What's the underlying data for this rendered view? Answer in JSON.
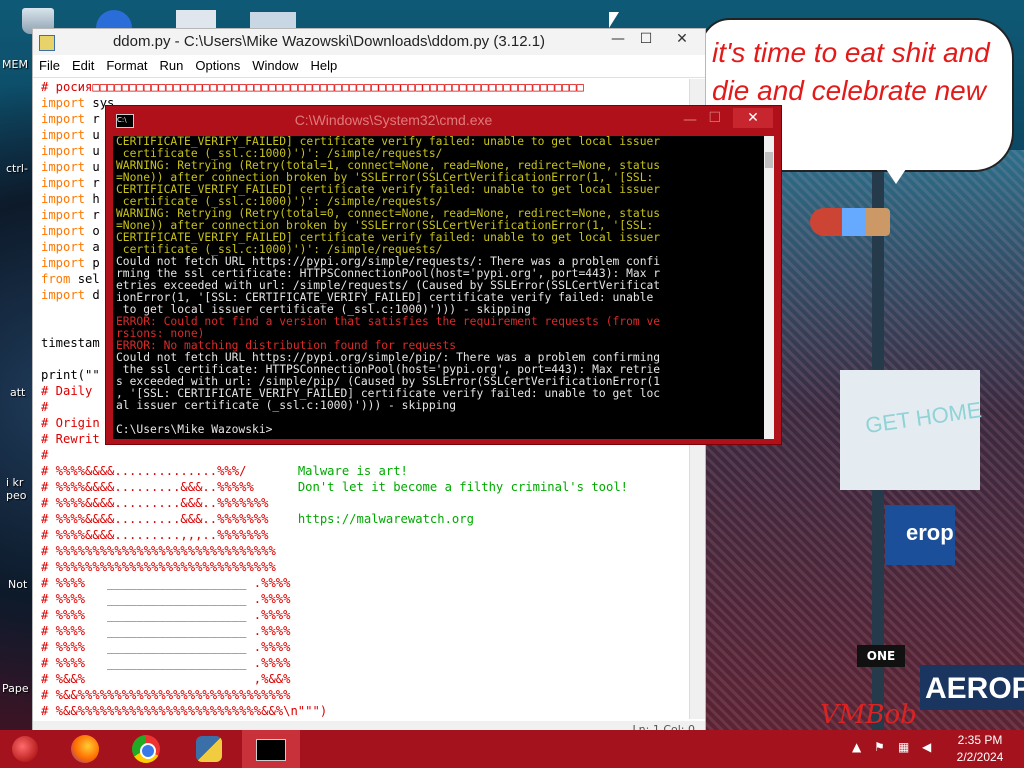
{
  "wallpaper": {
    "speech_bubble": "it's time to eat shit and die and celebrate new year",
    "sign_one": "ONE",
    "bldg1_text": "GET HOME",
    "bldg2_text": "erop",
    "bldg3_text": "AEROPOS",
    "signature": "VMBob"
  },
  "desktop_icons": [
    {
      "label": "MEM"
    },
    {
      "label": "ctrl-"
    },
    {
      "label": "att"
    },
    {
      "label": "i kr peo"
    },
    {
      "label": "Not"
    },
    {
      "label": "Pape"
    }
  ],
  "idle": {
    "title": "ddom.py - C:\\Users\\Mike Wazowski\\Downloads\\ddom.py (3.12.1)",
    "menu": [
      "File",
      "Edit",
      "Format",
      "Run",
      "Options",
      "Window",
      "Help"
    ],
    "status": "Ln: 1   Col: 0",
    "code_header": "# росия",
    "code_header_boxes": "□□□□□□□□□□□□□□□□□□□□□□□□□□□□□□□□□□□□□□□□□□□□□□□□□□□□□□□□□□□□□□□□□□□",
    "imports": [
      {
        "kw": "import",
        "rest": " sys"
      },
      {
        "kw": "import",
        "rest": " r"
      },
      {
        "kw": "import",
        "rest": " u"
      },
      {
        "kw": "import",
        "rest": " u"
      },
      {
        "kw": "import",
        "rest": " u"
      },
      {
        "kw": "import",
        "rest": " r"
      },
      {
        "kw": "import",
        "rest": " h"
      },
      {
        "kw": "import",
        "rest": " r"
      },
      {
        "kw": "import",
        "rest": " o"
      },
      {
        "kw": "import",
        "rest": " a"
      },
      {
        "kw": "import",
        "rest": " p"
      },
      {
        "kw": "from",
        "rest": " sel"
      },
      {
        "kw": "import",
        "rest": " d"
      }
    ],
    "timestamp_line": "timestam",
    "print_line": "print(\"\"",
    "comments": [
      "# Daily",
      "#",
      "# Origin",
      "# Rewrit",
      "#"
    ],
    "art_lines": [
      {
        "art": "# %%%%&&&&..............%%%/",
        "msg": "       Malware is art!"
      },
      {
        "art": "# %%%%&&&&.........&&&..%%%%%",
        "msg": "      Don't let it become a filthy criminal's tool!"
      },
      {
        "art": "# %%%%&&&&.........&&&..%%%%%%%",
        "msg": ""
      },
      {
        "art": "# %%%%&&&&.........&&&..%%%%%%%",
        "msg": "    https://malwarewatch.org"
      },
      {
        "art": "# %%%%&&&&.........,,,..%%%%%%%",
        "msg": ""
      },
      {
        "art": "# %%%%%%%%%%%%%%%%%%%%%%%%%%%%%%",
        "msg": ""
      },
      {
        "art": "# %%%%%%%%%%%%%%%%%%%%%%%%%%%%%%",
        "msg": ""
      },
      {
        "art": "# %%%%   ___________________ .%%%%",
        "msg": ""
      },
      {
        "art": "# %%%%   ___________________ .%%%%",
        "msg": ""
      },
      {
        "art": "# %%%%   ___________________ .%%%%",
        "msg": ""
      },
      {
        "art": "# %%%%   ___________________ .%%%%",
        "msg": ""
      },
      {
        "art": "# %%%%   ___________________ .%%%%",
        "msg": ""
      },
      {
        "art": "# %%%%   ___________________ .%%%%",
        "msg": ""
      },
      {
        "art": "# %&&%                       ,%&&%",
        "msg": ""
      },
      {
        "art": "# %&&%%%%%%%%%%%%%%%%%%%%%%%%%%%%%",
        "msg": ""
      },
      {
        "art": "# %&&%%%%%%%%%%%%%%%%%%%%%%%%%&&%\\n\"\"\")",
        "msg": ""
      }
    ]
  },
  "cmd": {
    "title": "C:\\Windows\\System32\\cmd.exe",
    "close_label": "✕",
    "lines": [
      {
        "c": "y",
        "t": "CERTIFICATE_VERIFY_FAILED] certificate verify failed: unable to get local issuer"
      },
      {
        "c": "y",
        "t": " certificate (_ssl.c:1000)')': /simple/requests/"
      },
      {
        "c": "y",
        "t": "WARNING: Retrying (Retry(total=1, connect=None, read=None, redirect=None, status"
      },
      {
        "c": "y",
        "t": "=None)) after connection broken by 'SSLError(SSLCertVerificationError(1, '[SSL:"
      },
      {
        "c": "y",
        "t": "CERTIFICATE_VERIFY_FAILED] certificate verify failed: unable to get local issuer"
      },
      {
        "c": "y",
        "t": " certificate (_ssl.c:1000)')': /simple/requests/"
      },
      {
        "c": "y",
        "t": "WARNING: Retrying (Retry(total=0, connect=None, read=None, redirect=None, status"
      },
      {
        "c": "y",
        "t": "=None)) after connection broken by 'SSLError(SSLCertVerificationError(1, '[SSL:"
      },
      {
        "c": "y",
        "t": "CERTIFICATE_VERIFY_FAILED] certificate verify failed: unable to get local issuer"
      },
      {
        "c": "y",
        "t": " certificate (_ssl.c:1000)')': /simple/requests/"
      },
      {
        "c": "w",
        "t": "Could not fetch URL https://pypi.org/simple/requests/: There was a problem confi"
      },
      {
        "c": "w",
        "t": "rming the ssl certificate: HTTPSConnectionPool(host='pypi.org', port=443): Max r"
      },
      {
        "c": "w",
        "t": "etries exceeded with url: /simple/requests/ (Caused by SSLError(SSLCertVerificat"
      },
      {
        "c": "w",
        "t": "ionError(1, '[SSL: CERTIFICATE_VERIFY_FAILED] certificate verify failed: unable"
      },
      {
        "c": "w",
        "t": " to get local issuer certificate (_ssl.c:1000)'))) - skipping"
      },
      {
        "c": "r",
        "t": "ERROR: Could not find a version that satisfies the requirement requests (from ve"
      },
      {
        "c": "r",
        "t": "rsions: none)"
      },
      {
        "c": "r",
        "t": "ERROR: No matching distribution found for requests"
      },
      {
        "c": "w",
        "t": "Could not fetch URL https://pypi.org/simple/pip/: There was a problem confirming"
      },
      {
        "c": "w",
        "t": " the ssl certificate: HTTPSConnectionPool(host='pypi.org', port=443): Max retrie"
      },
      {
        "c": "w",
        "t": "s exceeded with url: /simple/pip/ (Caused by SSLError(SSLCertVerificationError(1"
      },
      {
        "c": "w",
        "t": ", '[SSL: CERTIFICATE_VERIFY_FAILED] certificate verify failed: unable to get loc"
      },
      {
        "c": "w",
        "t": "al issuer certificate (_ssl.c:1000)'))) - skipping"
      },
      {
        "c": "w",
        "t": ""
      },
      {
        "c": "w",
        "t": "C:\\Users\\Mike Wazowski>"
      }
    ]
  },
  "taskbar": {
    "time": "2:35 PM",
    "date": "2/2/2024",
    "items": [
      {
        "name": "firefox",
        "icon": "firefox-icon"
      },
      {
        "name": "chrome",
        "icon": "chrome-icon"
      },
      {
        "name": "python-idle",
        "icon": "python-icon"
      },
      {
        "name": "cmd",
        "icon": "cmd-icon",
        "active": true
      }
    ]
  },
  "colors": {
    "taskbar": "#a3121d",
    "cmd_frame": "#b0101a",
    "warning_text": "#c8c31a",
    "error_text": "#d92a2a",
    "idle_keyword": "#ff7700",
    "idle_comment": "#dd0000",
    "idle_art_msg": "#00aa00"
  }
}
